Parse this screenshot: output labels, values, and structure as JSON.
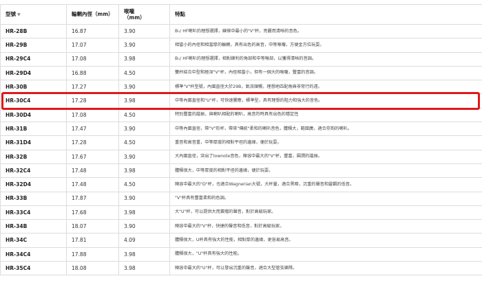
{
  "table": {
    "headers": {
      "model": "型號",
      "model_sort_icon": "▼",
      "inner_diameter": "輪輞內徑（mm）",
      "throat": "喉嚨（mm）",
      "features": "特點"
    },
    "rows": [
      {
        "model": "HR-28B",
        "inner_diameter": "16.87",
        "throat": "3.90",
        "features": "B♭/ HF喇叭的理想選擇，練徠中最小的\"V\"杯，亮麗而清晰的音色。"
      },
      {
        "model": "HR-29B",
        "inner_diameter": "17.07",
        "throat": "3.90",
        "features": "相當小的內徑和相當厚的輪輞，具有出色的高音，中等喉嚨，方便金方位玩耍。"
      },
      {
        "model": "HR-29C4",
        "inner_diameter": "17.08",
        "throat": "3.98",
        "features": "B♭/ HF喇叭的理想選擇，相對鋒利的角部和中等喉部，以獲得清晰的音調。"
      },
      {
        "model": "HR-29D4",
        "inner_diameter": "16.88",
        "throat": "4.50",
        "features": "雙杯結合中型和極深\"V\"杯，內徑相當小，但有一個大的喉嚨，豐富的音調。"
      },
      {
        "model": "HR-30B",
        "inner_diameter": "17.27",
        "throat": "3.90",
        "features": "標準\"V\"杯型號，內圍直徑大於29B，氣流順暢，理想地匹配角與非常行的遠。"
      },
      {
        "model": "HR-30C4",
        "inner_diameter": "17.28",
        "throat": "3.98",
        "features": "中等內圍直徑和\"U\"杯，可快速響應，標準型，具有理想的阻力和強大的音色。"
      },
      {
        "model": "HR-30D4",
        "inner_diameter": "17.08",
        "throat": "4.50",
        "features": "特別豐富的諧振，與喇叭相配的喇叭，高音符時具有出色的穩定性"
      },
      {
        "model": "HR-31B",
        "inner_diameter": "17.47",
        "throat": "3.90",
        "features": "中等內圍直徑，帶\"V\"形杯，帶來\"傳統\"柔和的喇叭音色，體積大，範圍廣，適合存韵的喇叭。"
      },
      {
        "model": "HR-31D4",
        "inner_diameter": "17.28",
        "throat": "4.50",
        "features": "重音和高音重，中等厚度的相對平坦的邊緣，便於玩耍。"
      },
      {
        "model": "HR-32B",
        "inner_diameter": "17.67",
        "throat": "3.90",
        "features": "大內圍直徑，突出了lownote音色，陣容中最大的\"V\"杯，豐富，圓潤的諧振。"
      },
      {
        "model": "HR-32C4",
        "inner_diameter": "17.48",
        "throat": "3.98",
        "features": "體積很大，中等厚度的相對平坦的邊緣，便於玩耍。"
      },
      {
        "model": "HR-32D4",
        "inner_diameter": "17.48",
        "throat": "4.50",
        "features": "陣容中最大的\"D\"杯，也適合Wagnerian大號，大杯量，適合黑暗，沉重的聲音和靈觀的低音。"
      },
      {
        "model": "HR-33B",
        "inner_diameter": "17.87",
        "throat": "3.90",
        "features": "\"V\"杯具有豐富柔和的色調。"
      },
      {
        "model": "HR-33C4",
        "inner_diameter": "17.68",
        "throat": "3.98",
        "features": "大\"U\"杯，可以提供大而黃贈的聲音，對於高級玩家。"
      },
      {
        "model": "HR-34B",
        "inner_diameter": "18.07",
        "throat": "3.90",
        "features": "陣容中最大的\"V\"杯，快捷的聲音和低音，對於高級玩家。"
      },
      {
        "model": "HR-34C",
        "inner_diameter": "17.81",
        "throat": "4.09",
        "features": "體積很大，U杯具有強大的性能，相對厚的邊緣，更容易高音。"
      },
      {
        "model": "HR-34C4",
        "inner_diameter": "17.88",
        "throat": "3.98",
        "features": "體積很大，\"U\"杯具有強大的性能。"
      },
      {
        "model": "HR-35C4",
        "inner_diameter": "18.08",
        "throat": "3.98",
        "features": "陣容中最大的\"U\"杯，可以發出沉重的聲音，適合大型管弦樂隊。"
      }
    ],
    "highlighted_row": "HR-30C4"
  }
}
